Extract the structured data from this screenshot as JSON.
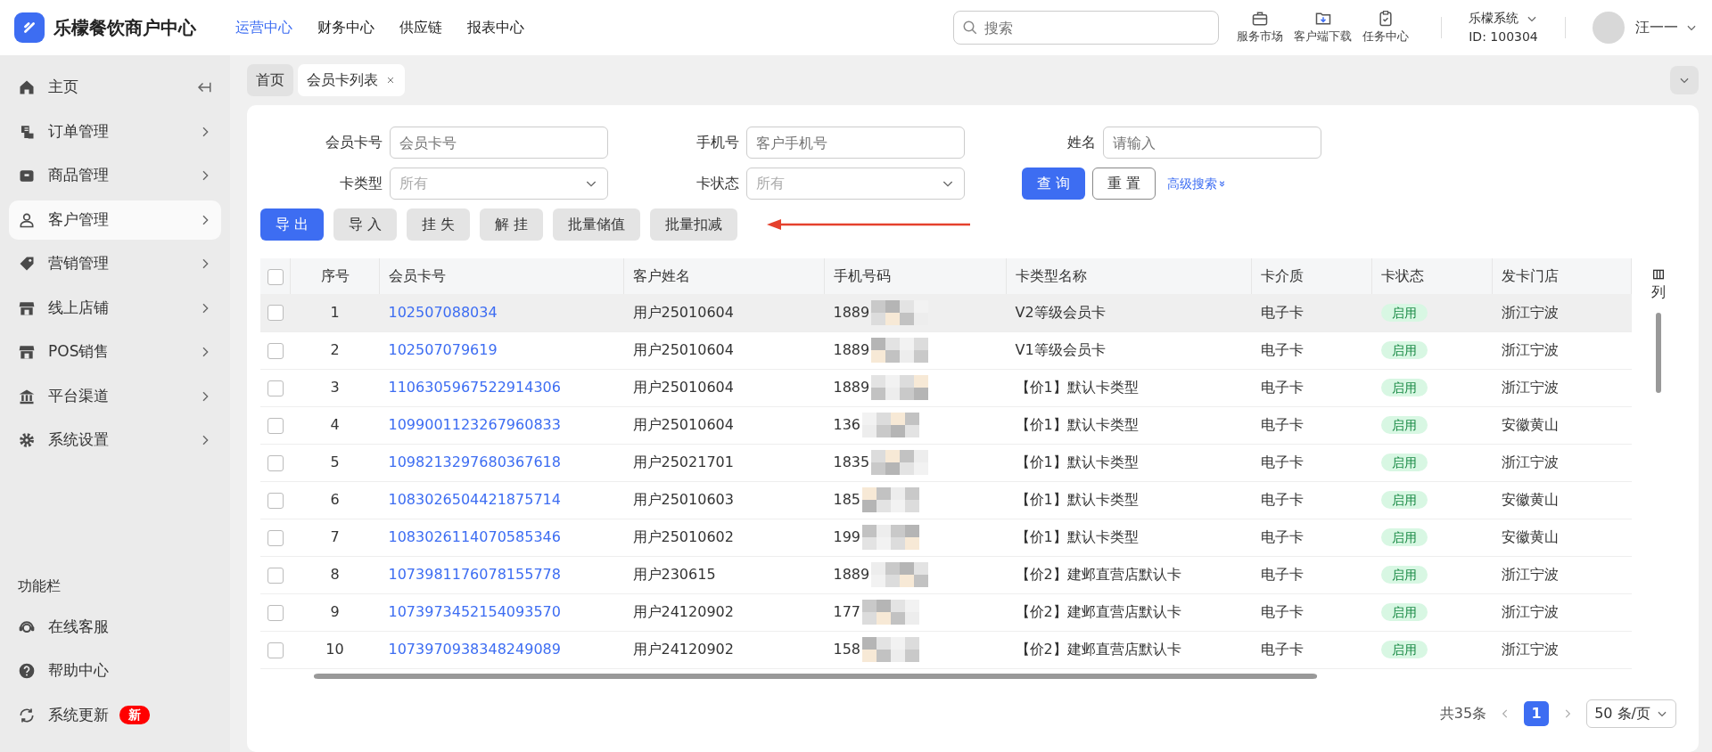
{
  "app": {
    "name": "乐檬餐饮商户中心"
  },
  "top_nav": [
    {
      "label": "运营中心",
      "selected": true
    },
    {
      "label": "财务中心",
      "selected": false
    },
    {
      "label": "供应链",
      "selected": false
    },
    {
      "label": "报表中心",
      "selected": false
    }
  ],
  "search": {
    "placeholder": "搜索"
  },
  "tools": [
    {
      "label": "服务市场",
      "kind": "market"
    },
    {
      "label": "客户端下载",
      "kind": "download"
    },
    {
      "label": "任务中心",
      "kind": "task"
    }
  ],
  "account": {
    "system": "乐檬系统",
    "id": "ID: 100304",
    "user": "汪一一"
  },
  "sidebar": {
    "items": [
      {
        "label": "主页",
        "kind": "home",
        "selected": false
      },
      {
        "label": "订单管理",
        "kind": "order",
        "selected": false
      },
      {
        "label": "商品管理",
        "kind": "goods",
        "selected": false
      },
      {
        "label": "客户管理",
        "kind": "customer",
        "selected": true
      },
      {
        "label": "营销管理",
        "kind": "tag",
        "selected": false
      },
      {
        "label": "线上店铺",
        "kind": "shop",
        "selected": false
      },
      {
        "label": "POS销售",
        "kind": "shop",
        "selected": false
      },
      {
        "label": "平台渠道",
        "kind": "bank",
        "selected": false
      },
      {
        "label": "系统设置",
        "kind": "gear",
        "selected": false
      }
    ],
    "section_title": "功能栏",
    "tools": [
      {
        "label": "在线客服",
        "kind": "service"
      },
      {
        "label": "帮助中心",
        "kind": "help"
      },
      {
        "label": "系统更新",
        "kind": "update",
        "badge": "新"
      }
    ]
  },
  "tabs": [
    {
      "label": "首页",
      "selected": false,
      "closable": false
    },
    {
      "label": "会员卡列表",
      "selected": true,
      "closable": true
    }
  ],
  "filters": [
    {
      "label": "会员卡号",
      "placeholder": "会员卡号",
      "kind": "text"
    },
    {
      "label": "手机号",
      "placeholder": "客户手机号",
      "kind": "text"
    },
    {
      "label": "姓名",
      "placeholder": "请输入",
      "kind": "text"
    },
    {
      "label": "卡类型",
      "value": "所有",
      "kind": "select"
    },
    {
      "label": "卡状态",
      "value": "所有",
      "kind": "select"
    }
  ],
  "filter_buttons": [
    {
      "label": "查 询",
      "kind": "primary"
    },
    {
      "label": "重 置",
      "kind": "outline"
    },
    {
      "label": "高级搜索",
      "kind": "link"
    }
  ],
  "actions": [
    {
      "label": "导 出",
      "kind": "primary"
    },
    {
      "label": "导 入",
      "kind": "secondary"
    },
    {
      "label": "挂 失",
      "kind": "secondary"
    },
    {
      "label": "解 挂",
      "kind": "secondary"
    },
    {
      "label": "批量储值",
      "kind": "secondary"
    },
    {
      "label": "批量扣减",
      "kind": "secondary"
    }
  ],
  "table": {
    "all_checked": false,
    "columns": [
      "序号",
      "会员卡号",
      "客户姓名",
      "手机号码",
      "卡类型名称",
      "卡介质",
      "卡状态",
      "发卡门店"
    ],
    "column_settings": "列",
    "rows": [
      {
        "index": "1",
        "card_no": "102507088034",
        "name": "用户25010604",
        "phone": "1889",
        "card_type": "V2等级会员卡",
        "medium": "电子卡",
        "status": "启用",
        "store": "浙江宁波",
        "checked": false,
        "hovered": true
      },
      {
        "index": "2",
        "card_no": "102507079619",
        "name": "用户25010604",
        "phone": "1889",
        "card_type": "V1等级会员卡",
        "medium": "电子卡",
        "status": "启用",
        "store": "浙江宁波",
        "checked": false,
        "hovered": false
      },
      {
        "index": "3",
        "card_no": "1106305967522914306",
        "name": "用户25010604",
        "phone": "1889",
        "card_type": "【价1】默认卡类型",
        "medium": "电子卡",
        "status": "启用",
        "store": "浙江宁波",
        "checked": false,
        "hovered": false
      },
      {
        "index": "4",
        "card_no": "1099001123267960833",
        "name": "用户25010604",
        "phone": "136",
        "card_type": "【价1】默认卡类型",
        "medium": "电子卡",
        "status": "启用",
        "store": "安徽黄山",
        "checked": false,
        "hovered": false
      },
      {
        "index": "5",
        "card_no": "1098213297680367618",
        "name": "用户25021701",
        "phone": "1835",
        "card_type": "【价1】默认卡类型",
        "medium": "电子卡",
        "status": "启用",
        "store": "浙江宁波",
        "checked": false,
        "hovered": false
      },
      {
        "index": "6",
        "card_no": "1083026504421875714",
        "name": "用户25010603",
        "phone": "185",
        "card_type": "【价1】默认卡类型",
        "medium": "电子卡",
        "status": "启用",
        "store": "安徽黄山",
        "checked": false,
        "hovered": false
      },
      {
        "index": "7",
        "card_no": "1083026114070585346",
        "name": "用户25010602",
        "phone": "199",
        "card_type": "【价1】默认卡类型",
        "medium": "电子卡",
        "status": "启用",
        "store": "安徽黄山",
        "checked": false,
        "hovered": false
      },
      {
        "index": "8",
        "card_no": "1073981176078155778",
        "name": "用户230615",
        "phone": "1889",
        "card_type": "【价2】建邺直营店默认卡",
        "medium": "电子卡",
        "status": "启用",
        "store": "浙江宁波",
        "checked": false,
        "hovered": false
      },
      {
        "index": "9",
        "card_no": "1073973452154093570",
        "name": "用户24120902",
        "phone": "177",
        "card_type": "【价2】建邺直营店默认卡",
        "medium": "电子卡",
        "status": "启用",
        "store": "浙江宁波",
        "checked": false,
        "hovered": false
      },
      {
        "index": "10",
        "card_no": "1073970938348249089",
        "name": "用户24120902",
        "phone": "158",
        "card_type": "【价2】建邺直营店默认卡",
        "medium": "电子卡",
        "status": "启用",
        "store": "浙江宁波",
        "checked": false,
        "hovered": false
      }
    ]
  },
  "pagination": {
    "total": "共35条",
    "pages": [
      {
        "label": "1",
        "selected": true
      }
    ],
    "page_size": "50 条/页"
  }
}
